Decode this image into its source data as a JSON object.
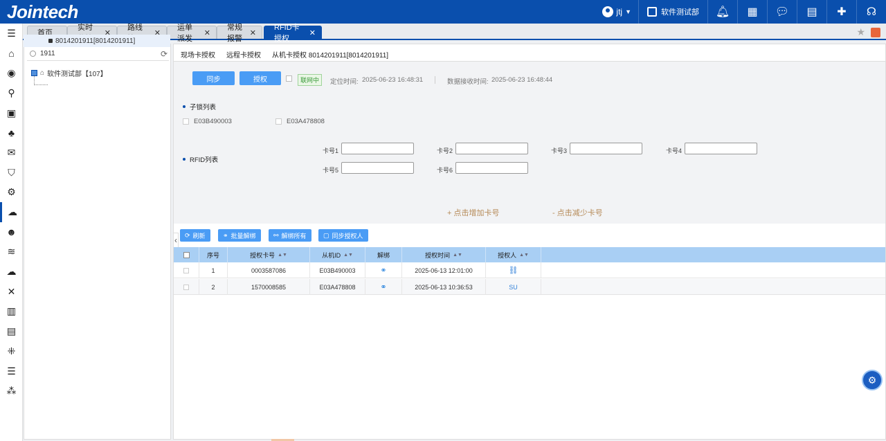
{
  "app": {
    "logo": "Jointech",
    "user_name": "jtj",
    "dept": "软件测试部"
  },
  "tabs": [
    {
      "label": "首页",
      "closable": false
    },
    {
      "label": "实时监控",
      "closable": true
    },
    {
      "label": "路线管理",
      "closable": true
    },
    {
      "label": "运单派发",
      "closable": true
    },
    {
      "label": "常规报警",
      "closable": true
    },
    {
      "label": "RFID卡授权",
      "closable": true,
      "active": true
    }
  ],
  "close_glyph": "✕",
  "tree": {
    "search_value": "1911",
    "root_label": "软件测试部【107】",
    "child_label": "8014201911[8014201911]"
  },
  "subtabs": [
    {
      "label": "现场卡授权"
    },
    {
      "label": "远程卡授权"
    },
    {
      "label": "从机卡授权 8014201911[8014201911]",
      "active": true
    }
  ],
  "actions": {
    "sync_label": "同步",
    "auth_label": "授权",
    "online_badge": "联网中",
    "location_time_label": "定位时间:",
    "location_time": "2025-06-23 16:48:31",
    "receive_time_label": "数据接收时间:",
    "receive_time": "2025-06-23 16:48:44"
  },
  "sublock": {
    "title": "子锁列表",
    "items": [
      "E03B490003",
      "E03A478808"
    ]
  },
  "rfid": {
    "title": "RFID列表",
    "card_labels": [
      "卡号1",
      "卡号2",
      "卡号3",
      "卡号4",
      "卡号5",
      "卡号6"
    ],
    "add_label": "+ 点击增加卡号",
    "remove_label": "- 点击减少卡号"
  },
  "toolbar": {
    "refresh": "刷新",
    "batch_unbind": "批量解绑",
    "unbind_all": "解绑所有",
    "sync_authorizer": "同步授权人"
  },
  "table": {
    "headers": [
      "序号",
      "授权卡号",
      "从机ID",
      "解绑",
      "授权时间",
      "授权人"
    ],
    "rows": [
      {
        "index": "1",
        "card": "0003587086",
        "slave_id": "E03B490003",
        "time": "2025-06-13 12:01:00",
        "authorizer": ""
      },
      {
        "index": "2",
        "card": "1570008585",
        "slave_id": "E03A478808",
        "time": "2025-06-13 10:36:53",
        "authorizer": "SU"
      }
    ]
  },
  "colors": {
    "brand": "#0a4fad",
    "button": "#4a9cf5",
    "table_header": "#a9cff4"
  }
}
